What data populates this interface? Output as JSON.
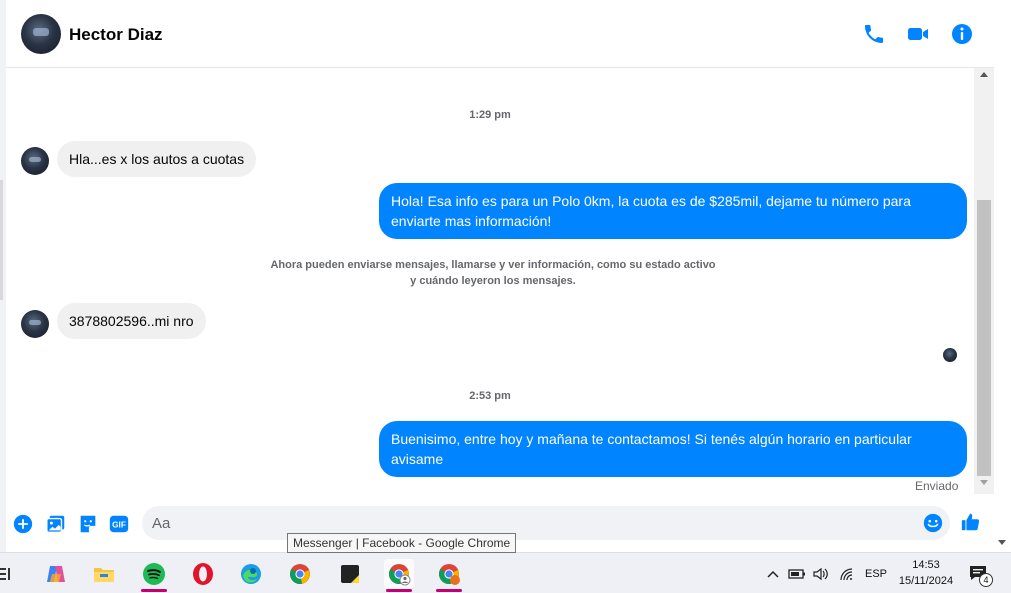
{
  "header": {
    "contact_name": "Hector Diaz"
  },
  "messages": {
    "time_1": "1:29 pm",
    "incoming_1": "Hla...es x los autos a cuotas",
    "outgoing_1": "Hola! Esa info es para un Polo 0km, la cuota es de $285mil, dejame tu número para enviarte mas información!",
    "system_notice": "Ahora pueden enviarse mensajes, llamarse y ver información, como su estado activo y cuándo leyeron los mensajes.",
    "incoming_2": "3878802596..mi nro",
    "time_2": "2:53 pm",
    "outgoing_2": "Buenisimo, entre hoy y mañana te contactamos! Si tenés algún horario en particular avisame",
    "status": "Enviado"
  },
  "composer": {
    "placeholder": "Aa"
  },
  "tooltip": "Messenger | Facebook - Google Chrome",
  "taskbar": {
    "language": "ESP",
    "time": "14:53",
    "date": "15/11/2024",
    "notification_count": "4"
  },
  "colors": {
    "accent": "#0084ff",
    "incoming_bubble": "#f0f0f0"
  }
}
